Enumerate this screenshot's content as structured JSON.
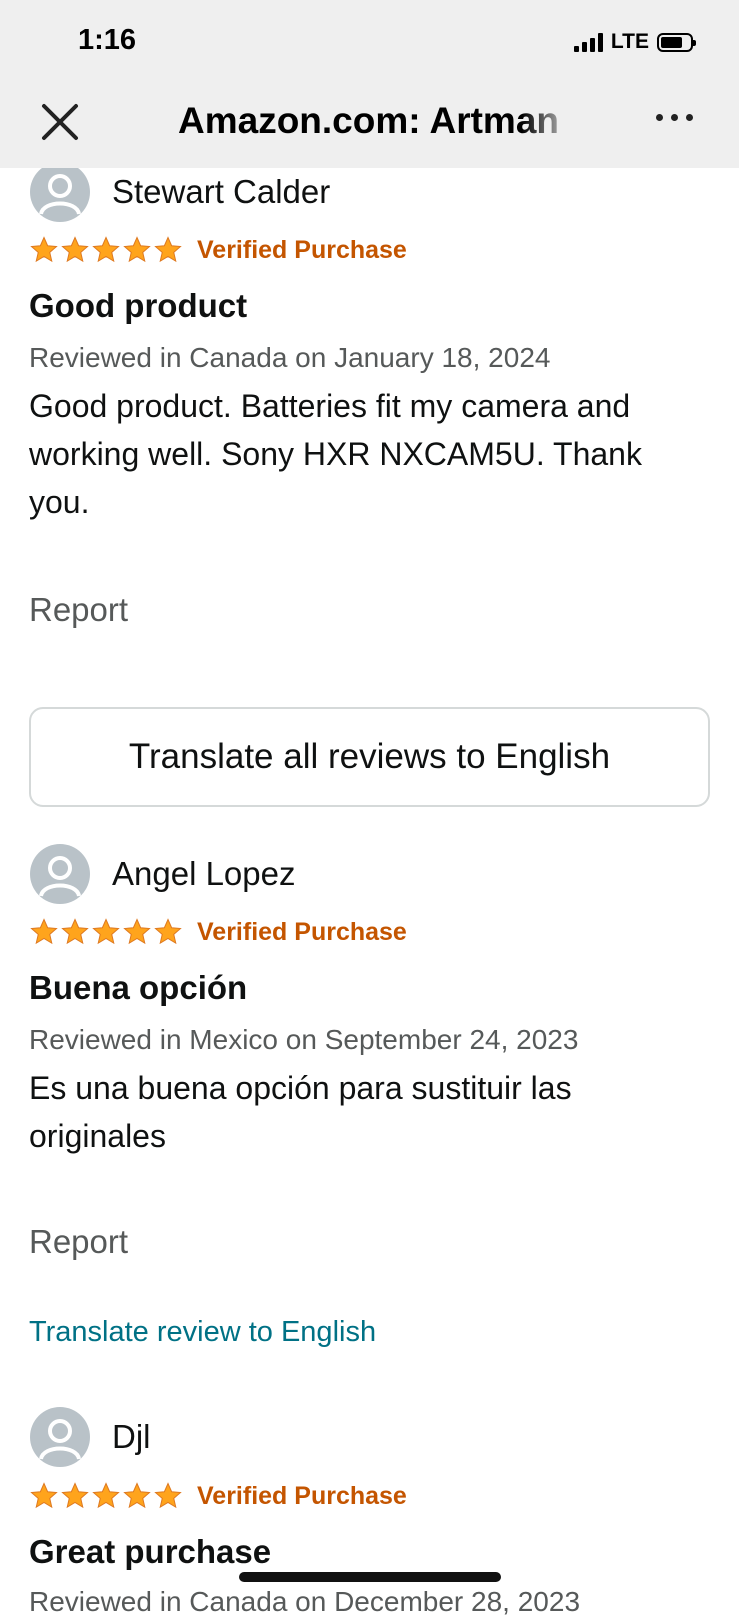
{
  "status_bar": {
    "time": "1:16",
    "network": "LTE"
  },
  "nav": {
    "title": "Amazon.com: Artman"
  },
  "reviews": [
    {
      "name": "Stewart Calder",
      "rating": 5,
      "verified": "Verified Purchase",
      "title": "Good product",
      "date": "Reviewed in Canada on January 18, 2024",
      "body": "Good product. Batteries fit my camera and working well. Sony HXR NXCAM5U. Thank you.",
      "report": "Report"
    },
    {
      "name": "Angel Lopez",
      "rating": 5,
      "verified": "Verified Purchase",
      "title": "Buena opción",
      "date": "Reviewed in Mexico on September 24, 2023",
      "body": "Es una buena opción para sustituir las originales",
      "report": "Report",
      "translate": "Translate review to English"
    },
    {
      "name": "Djl",
      "rating": 5,
      "verified": "Verified Purchase",
      "title": "Great purchase",
      "date": "Reviewed in Canada on December 28, 2023"
    }
  ],
  "translate_all_label": "Translate all reviews to English",
  "colors": {
    "star": "#ffa41c",
    "verified": "#c45500",
    "link": "#007185",
    "muted": "#565959"
  }
}
